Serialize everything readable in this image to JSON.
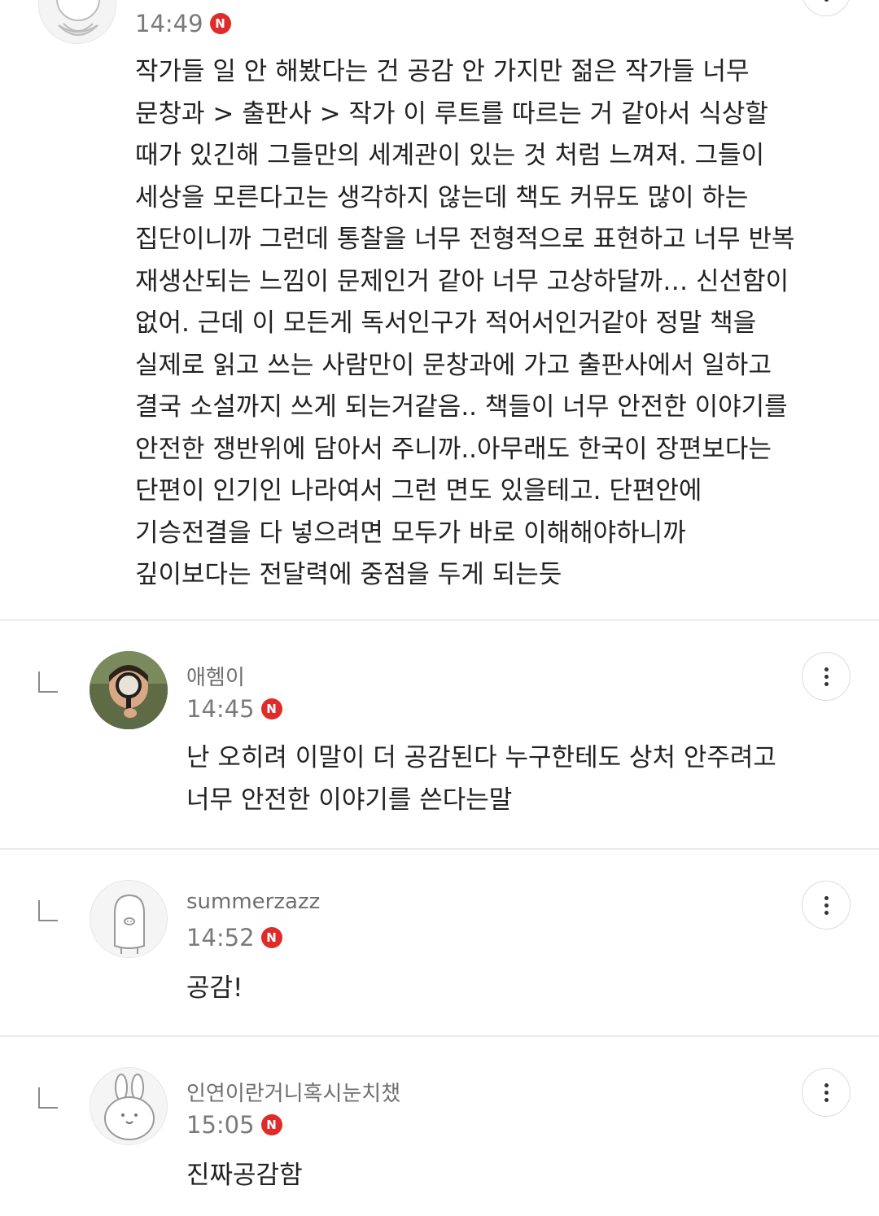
{
  "comments": [
    {
      "time": "14:49",
      "badge": "N",
      "text": "작가들 일 안 해봤다는 건 공감 안 가지만 젊은 작가들 너무\n문창과 > 출판사 > 작가 이 루트를 따르는 거 같아서 식상할\n때가 있긴해 그들만의 세계관이 있는 것 처럼 느껴져. 그들이\n세상을 모른다고는 생각하지 않는데 책도 커뮤도 많이 하는\n집단이니까 그런데 통찰을 너무 전형적으로 표현하고 너무 반복\n재생산되는 느낌이 문제인거 같아 너무 고상하달까… 신선함이\n없어. 근데 이 모든게 독서인구가 적어서인거같아 정말 책을\n실제로 읽고 쓰는 사람만이 문창과에 가고 출판사에서 일하고\n결국 소설까지 쓰게 되는거같음.. 책들이 너무 안전한 이야기를\n안전한 쟁반위에 담아서 주니까..아무래도 한국이 장편보다는\n단편이 인기인 나라여서 그런 면도 있을테고. 단편안에\n기승전결을 다 넣으려면 모두가 바로 이해해야하니까\n깊이보다는 전달력에 중점을 두게 되는듯"
    },
    {
      "nickname": "애헴이",
      "time": "14:45",
      "badge": "N",
      "text": "난 오히려 이말이 더 공감된다 누구한테도 상처 안주려고\n너무 안전한 이야기를 쓴다는말"
    },
    {
      "nickname": "summerzazz",
      "time": "14:52",
      "badge": "N",
      "text": "공감!"
    },
    {
      "nickname": "인연이란거니혹시눈치챘",
      "time": "15:05",
      "badge": "N",
      "text": "진짜공감함"
    }
  ]
}
